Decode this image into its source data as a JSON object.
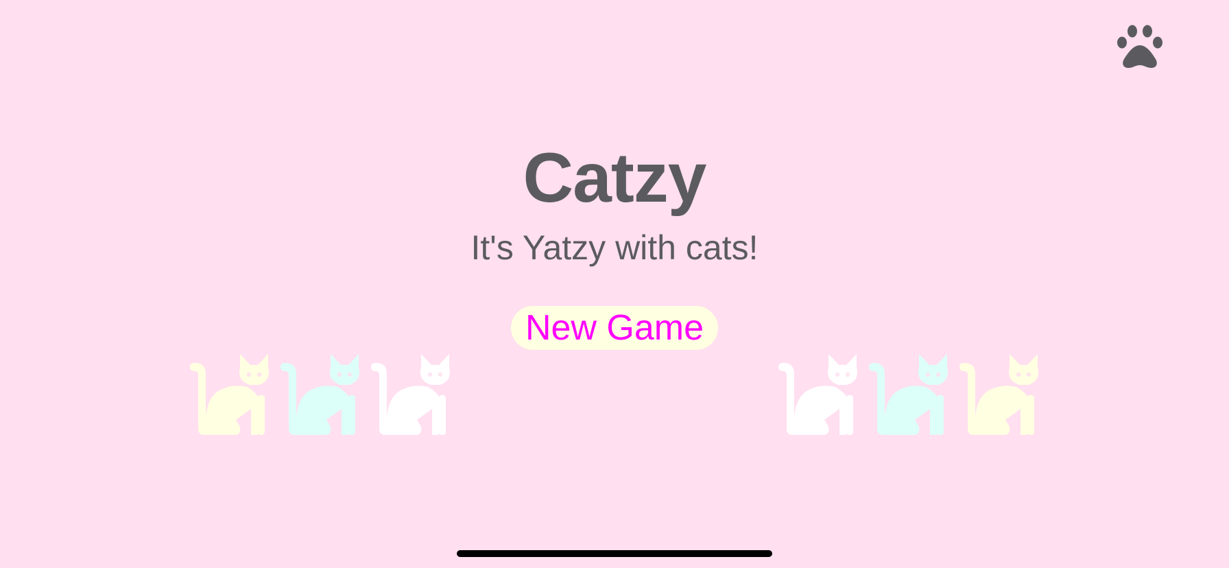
{
  "app": {
    "title": "Catzy",
    "subtitle": "It's Yatzy with cats!"
  },
  "actions": {
    "new_game_label": "New Game",
    "menu_icon": "paw-icon"
  },
  "decorations": {
    "cat_icon": "cat-silhouette-icon",
    "left_cats": [
      {
        "color": "#ffffe2"
      },
      {
        "color": "#ddfffa"
      },
      {
        "color": "#ffffff"
      }
    ],
    "right_cats": [
      {
        "color": "#ffffff"
      },
      {
        "color": "#ddfffa"
      },
      {
        "color": "#ffffe2"
      }
    ]
  },
  "colors": {
    "background": "#ffdff0",
    "text": "#5b5b5f",
    "button_background": "#ffffe2",
    "button_text": "#ff00ff"
  }
}
